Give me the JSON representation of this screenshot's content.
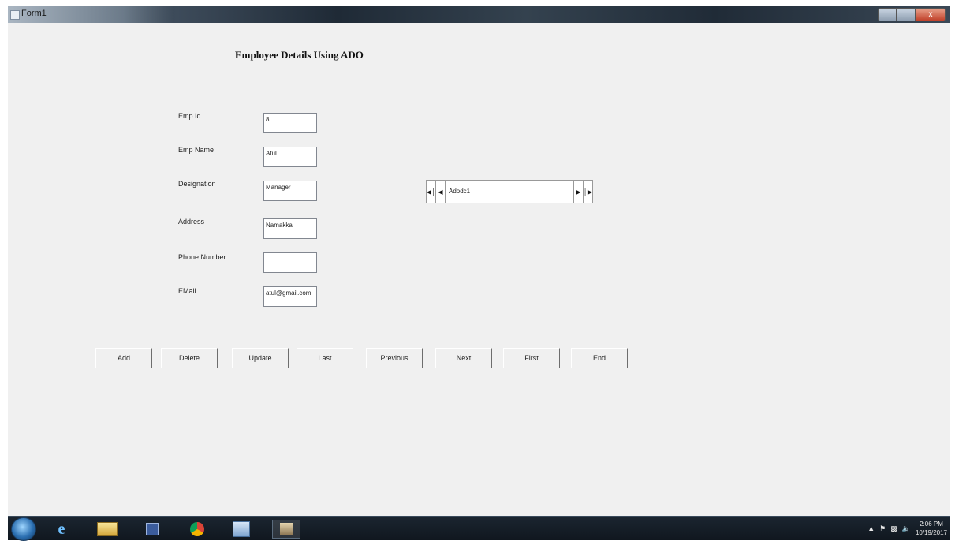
{
  "window": {
    "title": "Form1",
    "close_label": "x"
  },
  "form": {
    "title": "Employee Details Using ADO",
    "fields": [
      {
        "label": "Emp Id",
        "value": "8"
      },
      {
        "label": "Emp Name",
        "value": "Atul"
      },
      {
        "label": "Designation",
        "value": "Manager"
      },
      {
        "label": "Address",
        "value": "Namakkal"
      },
      {
        "label": "Phone Number",
        "value": ""
      },
      {
        "label": "EMail",
        "value": "atul@gmail.com"
      }
    ],
    "adodc": {
      "caption": "Adodc1"
    },
    "buttons": [
      "Add",
      "Delete",
      "Update",
      "Last",
      "Previous",
      "Next",
      "First",
      "End"
    ]
  },
  "taskbar": {
    "icons": [
      "start-orb",
      "internet-explorer-icon",
      "file-explorer-icon",
      "media-player-icon",
      "chrome-icon",
      "visual-basic-icon",
      "app-icon"
    ],
    "clock_time": "2:06 PM",
    "clock_date": "10/19/2017"
  }
}
